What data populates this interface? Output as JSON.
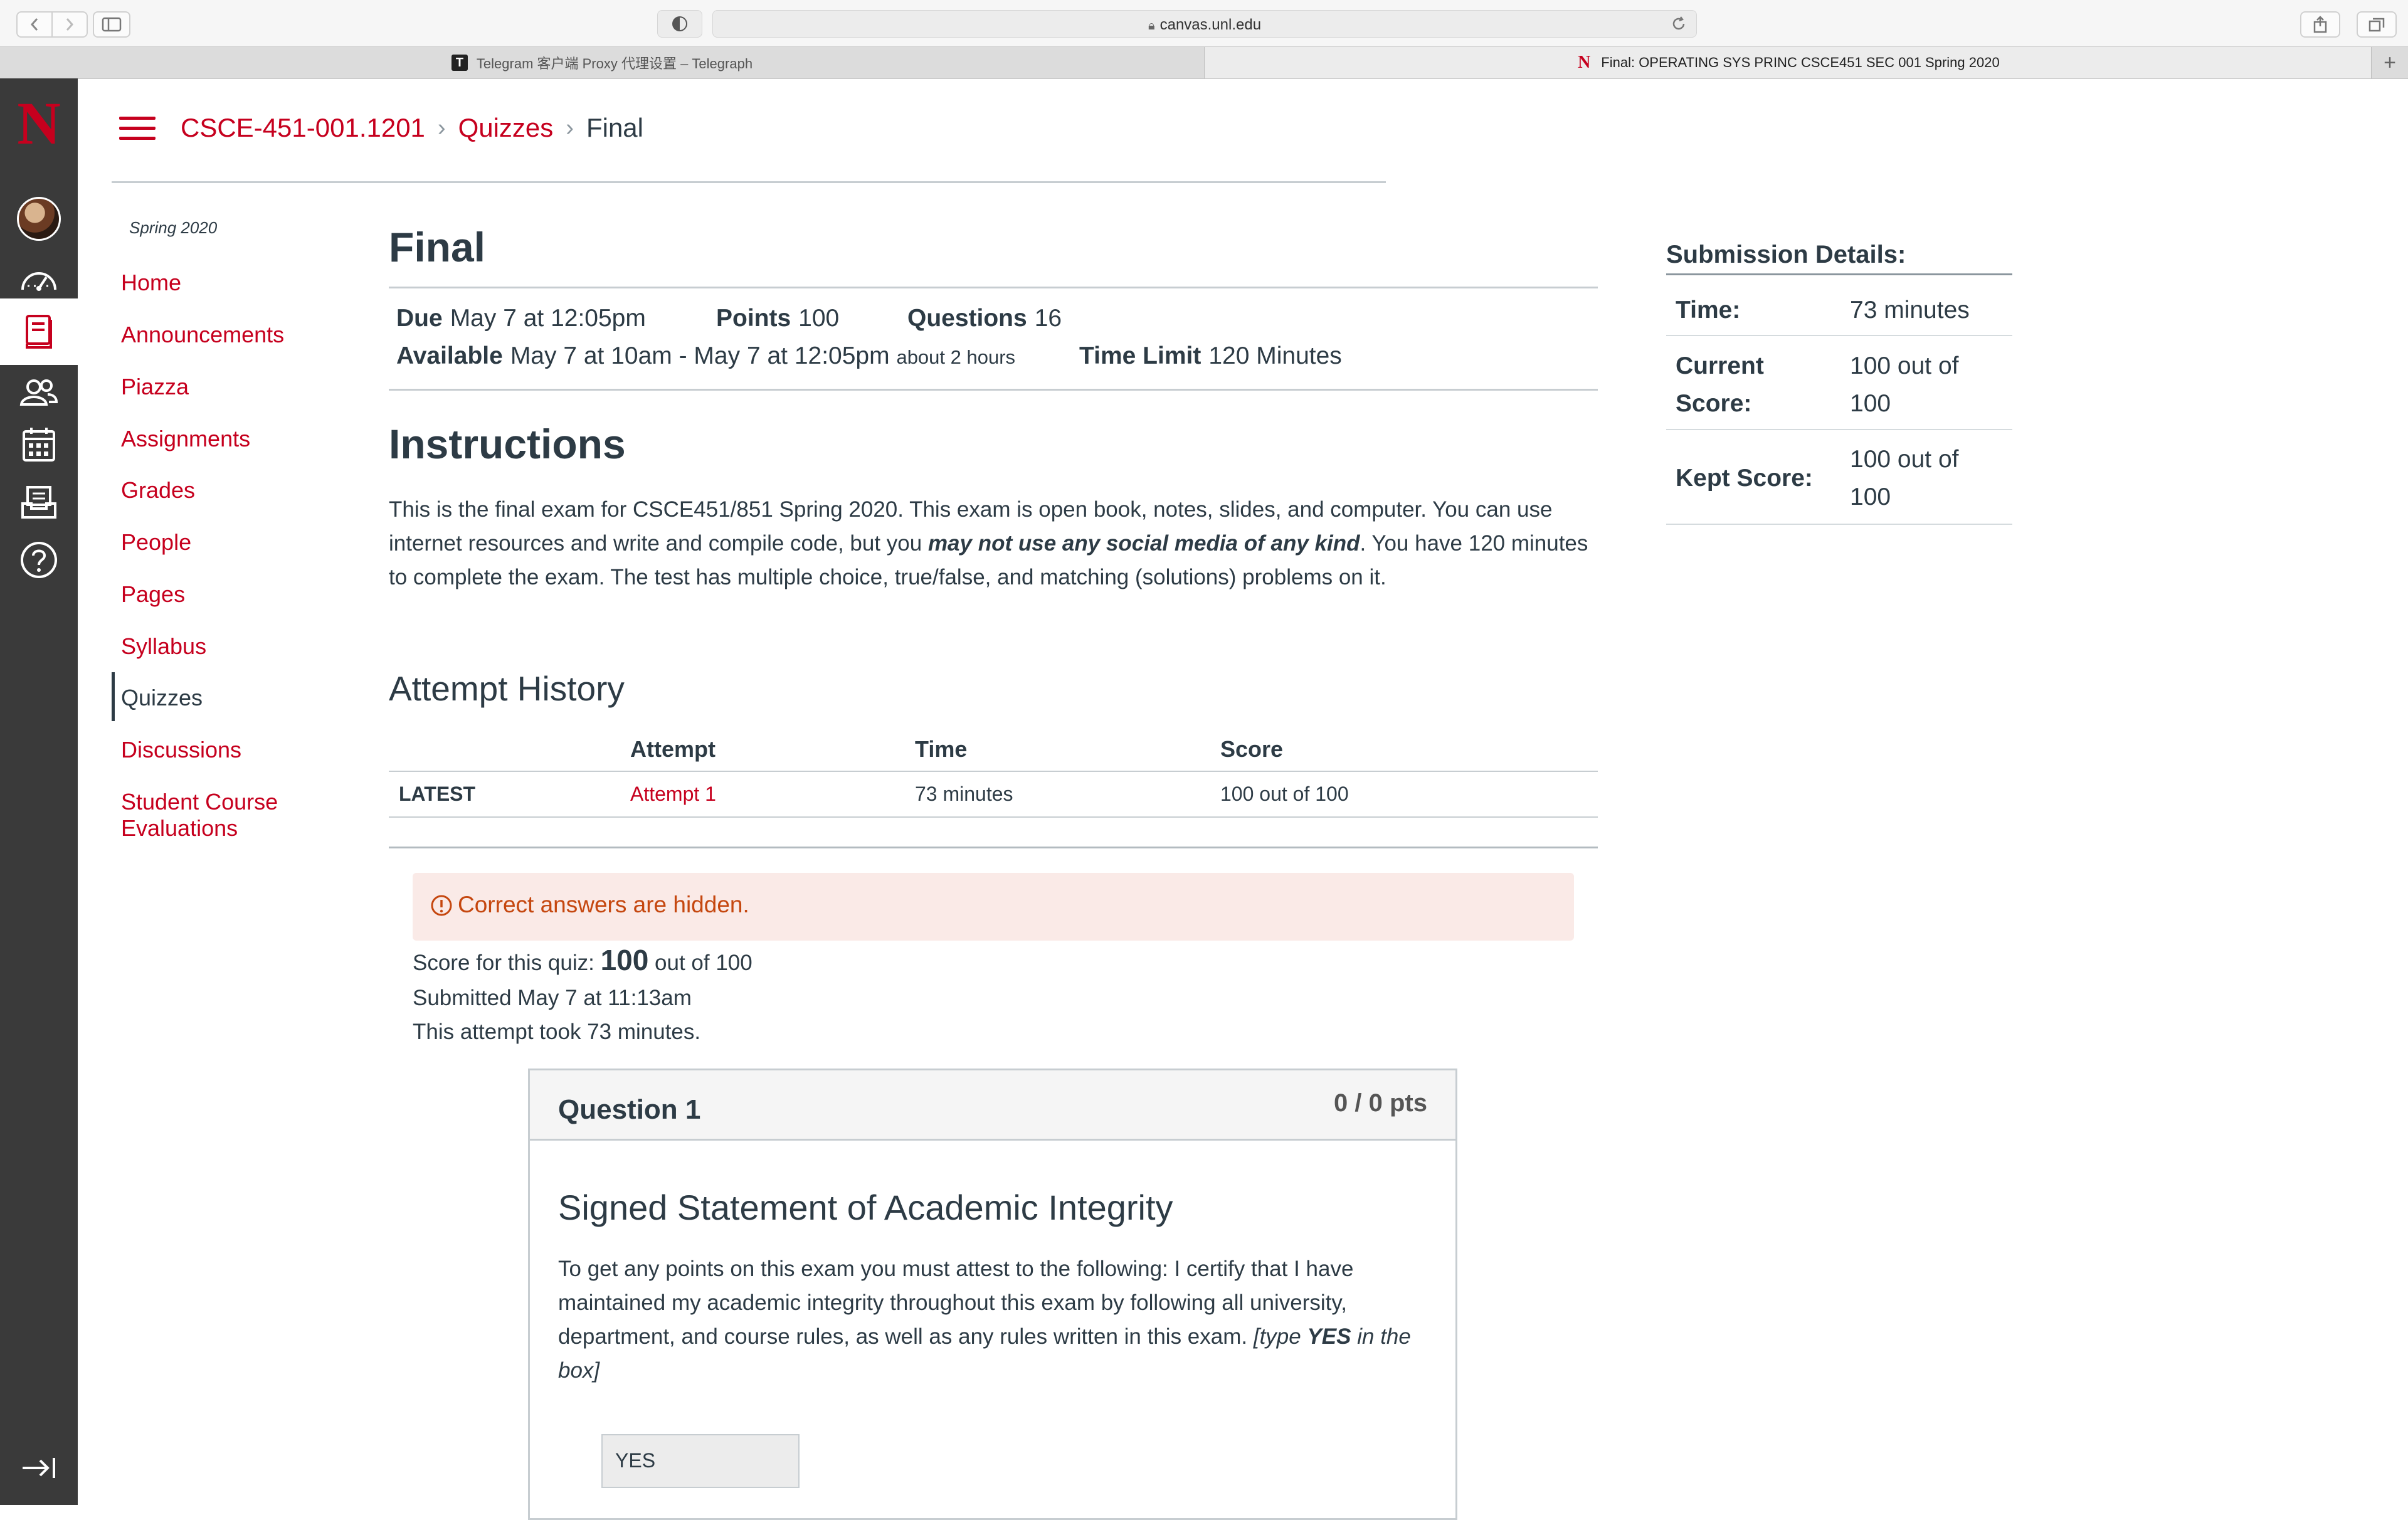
{
  "browser": {
    "url": "canvas.unl.edu",
    "tabs": [
      {
        "label": "Telegram 客户端 Proxy 代理设置 – Telegraph",
        "favicon": "T"
      },
      {
        "label": "Final: OPERATING SYS PRINC CSCE451 SEC 001 Spring 2020",
        "favicon": "N"
      }
    ]
  },
  "global_nav": {
    "logo": "N",
    "brand_color": "#c6001e",
    "items": [
      "avatar",
      "dashboard-icon",
      "courses-icon",
      "groups-icon",
      "calendar-icon",
      "inbox-icon",
      "help-icon"
    ],
    "collapse_icon": "collapse-nav-icon"
  },
  "breadcrumb": {
    "course": "CSCE-451-001.1201",
    "section": "Quizzes",
    "current": "Final"
  },
  "course_nav": {
    "term": "Spring 2020",
    "items": [
      {
        "label": "Home"
      },
      {
        "label": "Announcements"
      },
      {
        "label": "Piazza"
      },
      {
        "label": "Assignments"
      },
      {
        "label": "Grades"
      },
      {
        "label": "People"
      },
      {
        "label": "Pages"
      },
      {
        "label": "Syllabus"
      },
      {
        "label": "Quizzes"
      },
      {
        "label": "Discussions"
      },
      {
        "label": "Student Course",
        "label2": "Evaluations"
      }
    ],
    "active": "Quizzes"
  },
  "quiz": {
    "title": "Final",
    "due_label": "Due",
    "due_value": "May 7 at 12:05pm",
    "points_label": "Points",
    "points_value": "100",
    "questions_label": "Questions",
    "questions_value": "16",
    "available_label": "Available",
    "available_value": "May 7 at 10am - May 7 at 12:05pm",
    "available_note": "about 2 hours",
    "time_limit_label": "Time Limit",
    "time_limit_value": "120 Minutes",
    "instructions_heading": "Instructions",
    "instructions_part1": "This is the final exam for CSCE451/851 Spring 2020. This exam is open book, notes, slides, and computer. You can use internet resources and write and compile code, but you ",
    "instructions_emphasis": "may not use any social media of any kind",
    "instructions_part2": ". You have 120 minutes to complete the exam. The test has multiple choice, true/false, and matching (solutions) problems on it."
  },
  "attempt_history": {
    "heading": "Attempt History",
    "columns": [
      "",
      "Attempt",
      "Time",
      "Score"
    ],
    "rows": [
      {
        "tag": "LATEST",
        "attempt": "Attempt 1",
        "time": "73 minutes",
        "score": "100 out of 100"
      }
    ]
  },
  "alert": {
    "text": "Correct answers are hidden.",
    "icon": "warning-circle-icon"
  },
  "result": {
    "score_prefix": "Score for this quiz: ",
    "score_value": "100",
    "score_suffix": " out of 100",
    "submitted": "Submitted May 7 at 11:13am",
    "duration": "This attempt took 73 minutes."
  },
  "question": {
    "title": "Question 1",
    "points": "0 / 0 pts",
    "subtitle": "Signed Statement of Academic Integrity",
    "text_part1": "To get any points on this exam you must attest to the following: I certify that I have maintained my academic integrity throughout this exam by following all university, department, and course rules, as well as any rules written in this exam. ",
    "text_italic1": "[type ",
    "text_italic_bold": "YES",
    "text_italic2": " in the box]",
    "answer": "YES"
  },
  "submission_details": {
    "heading": "Submission Details:",
    "rows": [
      {
        "label": "Time:",
        "value": "73 minutes"
      },
      {
        "label": "Current",
        "label2": "Score:",
        "value": "100 out of",
        "value2": "100"
      },
      {
        "label": "Kept Score:",
        "value": "100 out of",
        "value2": "100"
      }
    ]
  }
}
